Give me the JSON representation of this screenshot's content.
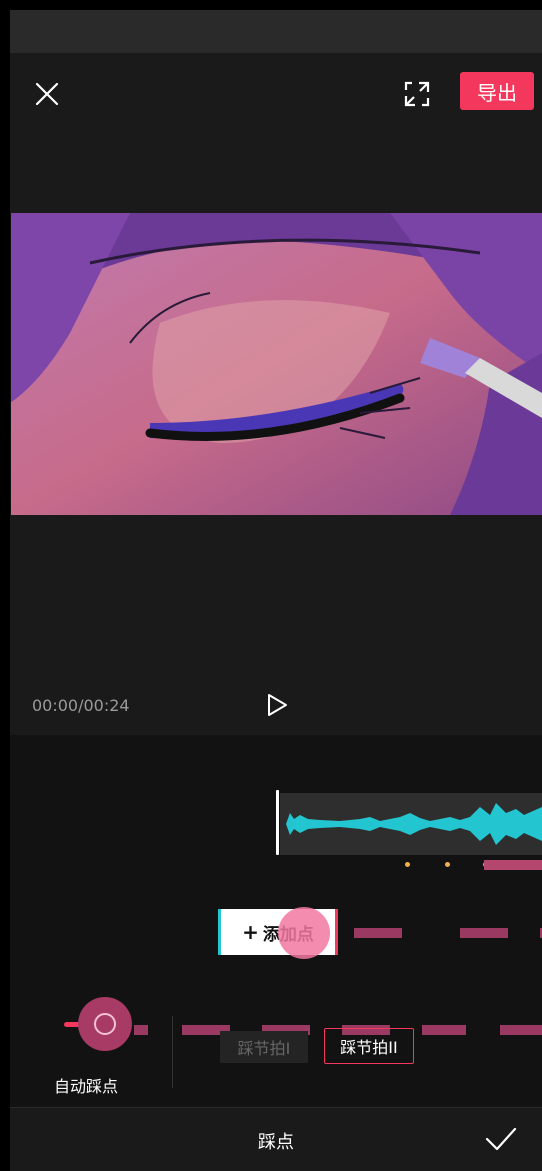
{
  "topbar": {
    "close_icon": "close-icon",
    "fullscreen_icon": "fullscreen-icon",
    "export_label": "导出",
    "accent_color": "#f4375c"
  },
  "player": {
    "timecode": "00:00/00:24",
    "play_icon": "play-icon"
  },
  "editor": {
    "add_point_label": "添加点",
    "add_point_icon": "plus-icon",
    "auto_beat_label": "自动踩点",
    "auto_beat_on": true,
    "modes": [
      {
        "label": "踩节拍I",
        "selected": false
      },
      {
        "label": "踩节拍II",
        "selected": true
      }
    ],
    "waveform_color": "#23c5d0",
    "beat_dot_color": "#f2b04d"
  },
  "bottombar": {
    "title": "踩点",
    "confirm_icon": "check-icon"
  }
}
